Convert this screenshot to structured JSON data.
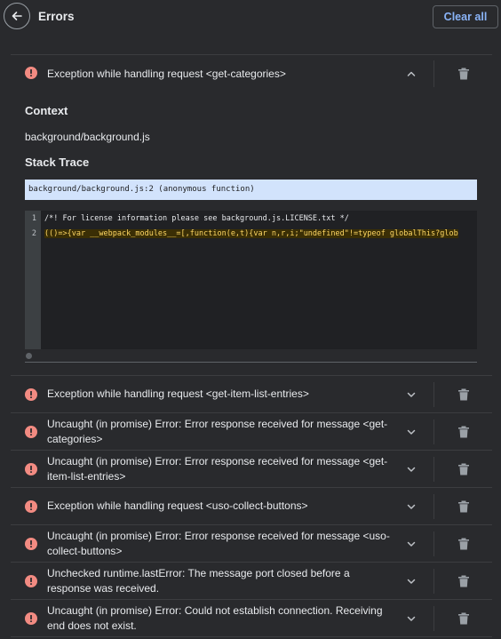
{
  "header": {
    "title": "Errors",
    "clear_all_label": "Clear all"
  },
  "expanded_error": {
    "message": "Exception while handling request <get-categories>",
    "context_label": "Context",
    "context_value": "background/background.js",
    "stack_trace_label": "Stack Trace",
    "stack_frame": "background/background.js:2 (anonymous function)",
    "code_lines": [
      {
        "number": "1",
        "text": "/*! For license information please see background.js.LICENSE.txt */"
      },
      {
        "number": "2",
        "text": "(()=>{var __webpack_modules__=[,function(e,t){var n,r,i;\"undefined\"!=typeof globalThis?glob"
      }
    ]
  },
  "errors": [
    {
      "message": "Exception while handling request <get-item-list-entries>"
    },
    {
      "message": "Uncaught (in promise) Error: Error response received for message <get-categories>"
    },
    {
      "message": "Uncaught (in promise) Error: Error response received for message <get-item-list-entries>"
    },
    {
      "message": "Exception while handling request <uso-collect-buttons>"
    },
    {
      "message": "Uncaught (in promise) Error: Error response received for message <uso-collect-buttons>"
    },
    {
      "message": "Unchecked runtime.lastError: The message port closed before a response was received."
    },
    {
      "message": "Uncaught (in promise) Error: Could not establish connection. Receiving end does not exist."
    }
  ],
  "colors": {
    "background": "#292a2d",
    "error_icon": "#f28b82",
    "accent": "#8ab4f8",
    "highlight_frame": "#d2e3fc",
    "highlight_code": "#fdd663"
  },
  "icons": [
    "back-arrow-icon",
    "error-icon",
    "chevron-up-icon",
    "chevron-down-icon",
    "trash-icon"
  ]
}
